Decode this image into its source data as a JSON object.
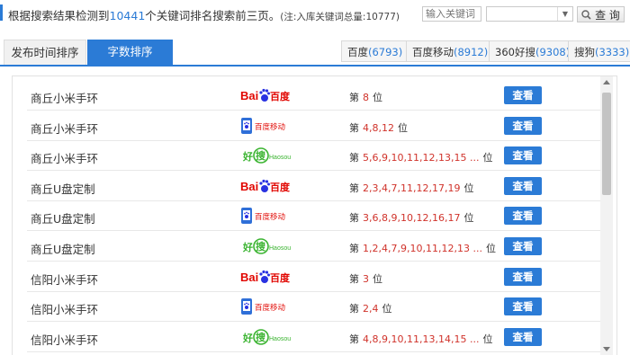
{
  "header": {
    "prefix": "根据搜索结果检测到",
    "count": "10441",
    "suffix": "个关键词排名搜索前三页。",
    "note": "(注:入库关键词总量:10777)"
  },
  "search": {
    "placeholder": "输入关键词",
    "select_value": "",
    "query_label": "查 询"
  },
  "tabs": [
    {
      "label": "发布时间排序",
      "active": false
    },
    {
      "label": "字数排序",
      "active": true
    }
  ],
  "engines": [
    {
      "name": "百度",
      "count": "(6793)"
    },
    {
      "name": "百度移动",
      "count": "(8912)"
    },
    {
      "name": "360好搜",
      "count": "(9308)"
    },
    {
      "name": "搜狗",
      "count": "(3333)"
    }
  ],
  "rank_prefix": "第",
  "rank_suffix": "位",
  "view_label": "查看",
  "logos": {
    "baidu_text1": "Bai",
    "baidu_text2": "百度",
    "baidu_mobile_text": "百度移动",
    "haosou_text1": "好",
    "haosou_text2": "搜",
    "haosou_sub": "Haosou"
  },
  "colors": {
    "accent": "#2b7bd6",
    "rank": "#d0332b",
    "baidu_red": "#e10601",
    "baidu_blue": "#2932e1",
    "haosou_green": "#3bb431"
  },
  "rows": [
    {
      "keyword": "商丘小米手环",
      "engine": "baidu",
      "ranks": "8"
    },
    {
      "keyword": "商丘小米手环",
      "engine": "baidu_mobile",
      "ranks": "4,8,12"
    },
    {
      "keyword": "商丘小米手环",
      "engine": "haosou",
      "ranks": "5,6,9,10,11,12,13,15 ..."
    },
    {
      "keyword": "商丘U盘定制",
      "engine": "baidu",
      "ranks": "2,3,4,7,11,12,17,19"
    },
    {
      "keyword": "商丘U盘定制",
      "engine": "baidu_mobile",
      "ranks": "3,6,8,9,10,12,16,17"
    },
    {
      "keyword": "商丘U盘定制",
      "engine": "haosou",
      "ranks": "1,2,4,7,9,10,11,12,13 ..."
    },
    {
      "keyword": "信阳小米手环",
      "engine": "baidu",
      "ranks": "3"
    },
    {
      "keyword": "信阳小米手环",
      "engine": "baidu_mobile",
      "ranks": "2,4"
    },
    {
      "keyword": "信阳小米手环",
      "engine": "haosou",
      "ranks": "4,8,9,10,11,13,14,15 ..."
    }
  ]
}
